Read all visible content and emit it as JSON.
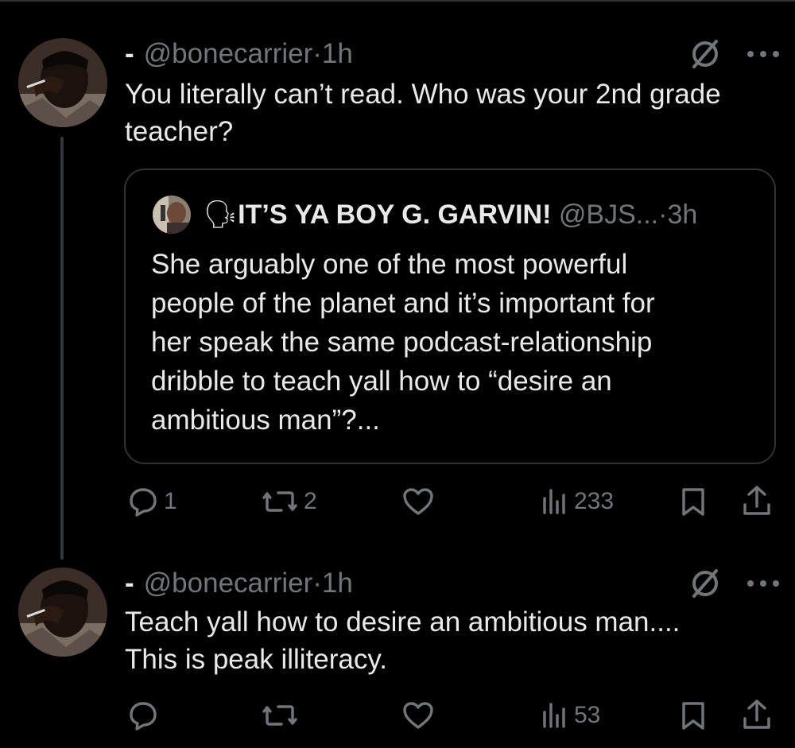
{
  "tweet1": {
    "display_name": "-",
    "handle": "@bonecarrier",
    "separator": "·",
    "time": "1h",
    "text_lines": [
      "You literally can’t read. Who was your 2nd grade",
      "teacher?"
    ],
    "quote": {
      "emoji": "🗣",
      "display_name": "IT’S YA BOY G. GARVIN!",
      "handle": "@BJS...",
      "separator": "·",
      "time": "3h",
      "text_lines": [
        "She arguably one of the most powerful",
        "people of the planet and it’s important for",
        "her speak the same podcast-relationship",
        "dribble to teach yall how to “desire an",
        "ambitious man”?..."
      ]
    },
    "actions": {
      "replies": "1",
      "reposts": "2",
      "likes": "",
      "views": "233"
    }
  },
  "tweet2": {
    "display_name": "-",
    "handle": "@bonecarrier",
    "separator": "·",
    "time": "1h",
    "text_lines": [
      "Teach yall how to desire an ambitious man....",
      "This is peak illiteracy."
    ],
    "actions": {
      "replies": "",
      "reposts": "",
      "likes": "",
      "views": "53"
    }
  },
  "icons": [
    "grok-icon",
    "more-icon",
    "reply-icon",
    "repost-icon",
    "like-icon",
    "views-icon",
    "bookmark-icon",
    "share-icon"
  ],
  "colors": {
    "background": "#000000",
    "text": "#e7e9ea",
    "secondary": "#71767b",
    "border": "#2f3336"
  }
}
